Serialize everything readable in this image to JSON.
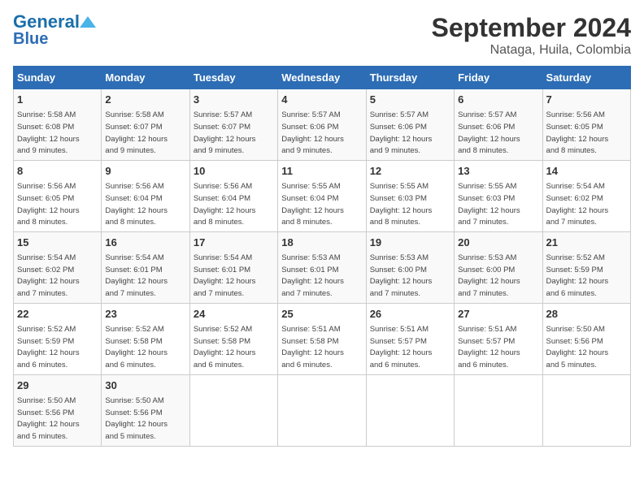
{
  "header": {
    "logo_line1": "General",
    "logo_line2": "Blue",
    "title": "September 2024",
    "subtitle": "Nataga, Huila, Colombia"
  },
  "columns": [
    "Sunday",
    "Monday",
    "Tuesday",
    "Wednesday",
    "Thursday",
    "Friday",
    "Saturday"
  ],
  "weeks": [
    [
      {
        "day": "1",
        "info": "Sunrise: 5:58 AM\nSunset: 6:08 PM\nDaylight: 12 hours\nand 9 minutes."
      },
      {
        "day": "2",
        "info": "Sunrise: 5:58 AM\nSunset: 6:07 PM\nDaylight: 12 hours\nand 9 minutes."
      },
      {
        "day": "3",
        "info": "Sunrise: 5:57 AM\nSunset: 6:07 PM\nDaylight: 12 hours\nand 9 minutes."
      },
      {
        "day": "4",
        "info": "Sunrise: 5:57 AM\nSunset: 6:06 PM\nDaylight: 12 hours\nand 9 minutes."
      },
      {
        "day": "5",
        "info": "Sunrise: 5:57 AM\nSunset: 6:06 PM\nDaylight: 12 hours\nand 9 minutes."
      },
      {
        "day": "6",
        "info": "Sunrise: 5:57 AM\nSunset: 6:06 PM\nDaylight: 12 hours\nand 8 minutes."
      },
      {
        "day": "7",
        "info": "Sunrise: 5:56 AM\nSunset: 6:05 PM\nDaylight: 12 hours\nand 8 minutes."
      }
    ],
    [
      {
        "day": "8",
        "info": "Sunrise: 5:56 AM\nSunset: 6:05 PM\nDaylight: 12 hours\nand 8 minutes."
      },
      {
        "day": "9",
        "info": "Sunrise: 5:56 AM\nSunset: 6:04 PM\nDaylight: 12 hours\nand 8 minutes."
      },
      {
        "day": "10",
        "info": "Sunrise: 5:56 AM\nSunset: 6:04 PM\nDaylight: 12 hours\nand 8 minutes."
      },
      {
        "day": "11",
        "info": "Sunrise: 5:55 AM\nSunset: 6:04 PM\nDaylight: 12 hours\nand 8 minutes."
      },
      {
        "day": "12",
        "info": "Sunrise: 5:55 AM\nSunset: 6:03 PM\nDaylight: 12 hours\nand 8 minutes."
      },
      {
        "day": "13",
        "info": "Sunrise: 5:55 AM\nSunset: 6:03 PM\nDaylight: 12 hours\nand 7 minutes."
      },
      {
        "day": "14",
        "info": "Sunrise: 5:54 AM\nSunset: 6:02 PM\nDaylight: 12 hours\nand 7 minutes."
      }
    ],
    [
      {
        "day": "15",
        "info": "Sunrise: 5:54 AM\nSunset: 6:02 PM\nDaylight: 12 hours\nand 7 minutes."
      },
      {
        "day": "16",
        "info": "Sunrise: 5:54 AM\nSunset: 6:01 PM\nDaylight: 12 hours\nand 7 minutes."
      },
      {
        "day": "17",
        "info": "Sunrise: 5:54 AM\nSunset: 6:01 PM\nDaylight: 12 hours\nand 7 minutes."
      },
      {
        "day": "18",
        "info": "Sunrise: 5:53 AM\nSunset: 6:01 PM\nDaylight: 12 hours\nand 7 minutes."
      },
      {
        "day": "19",
        "info": "Sunrise: 5:53 AM\nSunset: 6:00 PM\nDaylight: 12 hours\nand 7 minutes."
      },
      {
        "day": "20",
        "info": "Sunrise: 5:53 AM\nSunset: 6:00 PM\nDaylight: 12 hours\nand 7 minutes."
      },
      {
        "day": "21",
        "info": "Sunrise: 5:52 AM\nSunset: 5:59 PM\nDaylight: 12 hours\nand 6 minutes."
      }
    ],
    [
      {
        "day": "22",
        "info": "Sunrise: 5:52 AM\nSunset: 5:59 PM\nDaylight: 12 hours\nand 6 minutes."
      },
      {
        "day": "23",
        "info": "Sunrise: 5:52 AM\nSunset: 5:58 PM\nDaylight: 12 hours\nand 6 minutes."
      },
      {
        "day": "24",
        "info": "Sunrise: 5:52 AM\nSunset: 5:58 PM\nDaylight: 12 hours\nand 6 minutes."
      },
      {
        "day": "25",
        "info": "Sunrise: 5:51 AM\nSunset: 5:58 PM\nDaylight: 12 hours\nand 6 minutes."
      },
      {
        "day": "26",
        "info": "Sunrise: 5:51 AM\nSunset: 5:57 PM\nDaylight: 12 hours\nand 6 minutes."
      },
      {
        "day": "27",
        "info": "Sunrise: 5:51 AM\nSunset: 5:57 PM\nDaylight: 12 hours\nand 6 minutes."
      },
      {
        "day": "28",
        "info": "Sunrise: 5:50 AM\nSunset: 5:56 PM\nDaylight: 12 hours\nand 5 minutes."
      }
    ],
    [
      {
        "day": "29",
        "info": "Sunrise: 5:50 AM\nSunset: 5:56 PM\nDaylight: 12 hours\nand 5 minutes."
      },
      {
        "day": "30",
        "info": "Sunrise: 5:50 AM\nSunset: 5:56 PM\nDaylight: 12 hours\nand 5 minutes."
      },
      null,
      null,
      null,
      null,
      null
    ]
  ]
}
